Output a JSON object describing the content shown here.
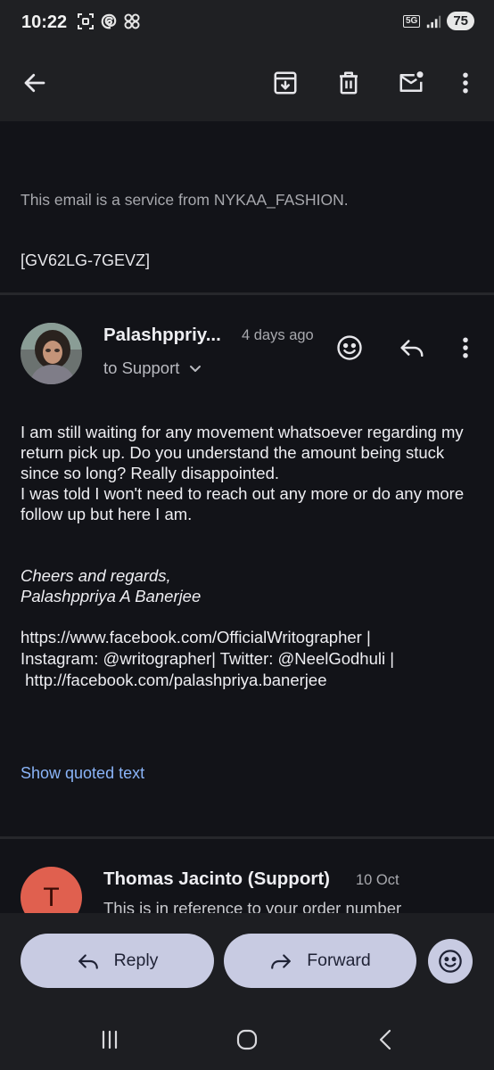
{
  "status_bar": {
    "time": "10:22",
    "network": "5G",
    "battery": "75",
    "icons": [
      "screenshot-icon",
      "threads-icon",
      "pinwheel-icon",
      "signal-icon"
    ]
  },
  "app_bar": {
    "icons": [
      "back-arrow-icon",
      "archive-icon",
      "delete-icon",
      "mark-unread-icon",
      "more-vert-icon"
    ]
  },
  "previous_message": {
    "footer_note": "This email is a service from NYKAA_FASHION.",
    "code": "[GV62LG-7GEVZ]"
  },
  "message": {
    "sender": "Palashppriy...",
    "time": "4 days ago",
    "recipient": "to Support",
    "body": [
      "I am still waiting for any movement whatsoever regarding my return pick up. Do you understand the amount being stuck since so long? Really disappointed.",
      "I was told I won't need to reach out any more or do any more follow up but here I am."
    ],
    "signature": [
      "Cheers and regards,",
      "Palashppriya A Banerjee"
    ],
    "links": [
      "https://www.facebook.com/OfficialWritographer |",
      "Instagram: @writographer| Twitter: @NeelGodhuli |",
      " http://facebook.com/palashpriya.banerjee"
    ],
    "show_quoted": "Show quoted text"
  },
  "next_message": {
    "avatar_letter": "T",
    "sender": "Thomas Jacinto (Support)",
    "time": "10 Oct",
    "snippet": "This is in reference to your order number"
  },
  "actions": {
    "reply": "Reply",
    "forward": "Forward"
  },
  "colors": {
    "background": "#121318",
    "app_bar": "#1f2023",
    "link": "#8ab4f8",
    "pill": "#c8cbe2",
    "avatar_t": "#e0604f"
  }
}
